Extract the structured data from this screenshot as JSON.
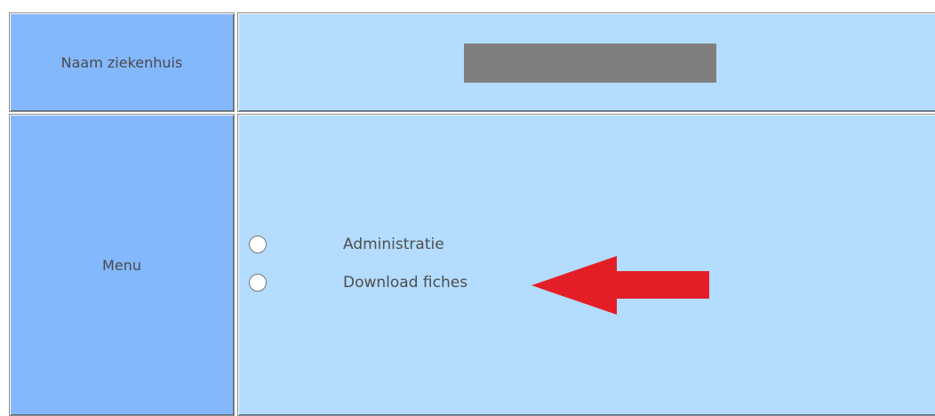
{
  "window": {
    "colors": {
      "label_cell": "#84b8fc",
      "content_cell": "#b3dcfe",
      "redaction": "#7f7f7f",
      "annotation_arrow": "#e41e26"
    }
  },
  "hospital_row": {
    "label": "Naam ziekenhuis",
    "value_redacted": true
  },
  "menu_row": {
    "label": "Menu",
    "options": [
      {
        "label": "Administratie",
        "selected": false
      },
      {
        "label": "Download fiches",
        "selected": false
      }
    ]
  },
  "annotation": {
    "icon": "red-arrow-left-icon",
    "points_to": "Download fiches"
  }
}
